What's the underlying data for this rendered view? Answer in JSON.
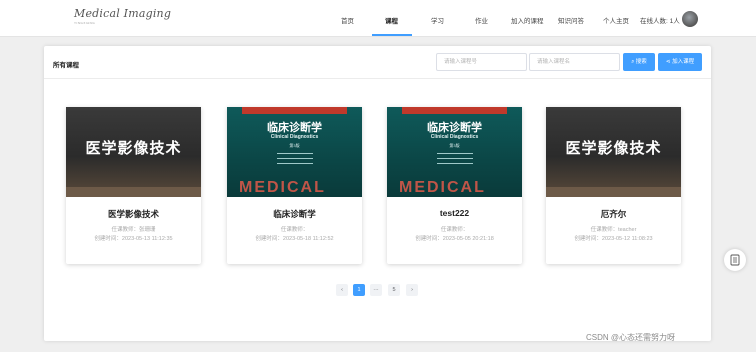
{
  "header": {
    "logo_text": "Medical Imaging",
    "logo_sub": "YINGXIANG",
    "nav": [
      "首页",
      "课程",
      "学习",
      "作业",
      "加入的课程",
      "知识问答",
      "个人主页"
    ],
    "active_nav": "课程",
    "online": "在线人数: 1人"
  },
  "panel": {
    "title": "所有课程",
    "search_code_placeholder": "请输入课程号",
    "search_name_placeholder": "请输入课程名",
    "search_button": "搜索",
    "join_button": "加入课程"
  },
  "courses": [
    {
      "cover": "医学影像技术",
      "name": "医学影像技术",
      "teacher": "任课教师：张珊珊",
      "created": "创建时间：2023-05-13 11:12:35"
    },
    {
      "cover": "临床诊断学",
      "cover_en": "Clinical Diagnostics",
      "edition": "第3版",
      "name": "临床诊断学",
      "teacher": "任课教师：",
      "created": "创建时间：2023-05-18 11:12:52"
    },
    {
      "cover": "临床诊断学",
      "cover_en": "Clinical Diagnostics",
      "edition": "第3版",
      "name": "test222",
      "teacher": "任课教师：",
      "created": "创建时间：2023-05-05 20:21:18"
    },
    {
      "cover": "医学影像技术",
      "name": "厄齐尔",
      "teacher": "任课教师：teacher",
      "created": "创建时间：2023-05-12 11:08:23"
    }
  ],
  "cover_bottom_text": "MEDICAL",
  "pagination": {
    "prev": "‹",
    "current": "1",
    "ellipsis": "···",
    "last": "5",
    "next": "›"
  },
  "watermark": "CSDN @心态还需努力呀",
  "colors": {
    "accent": "#409eff"
  }
}
